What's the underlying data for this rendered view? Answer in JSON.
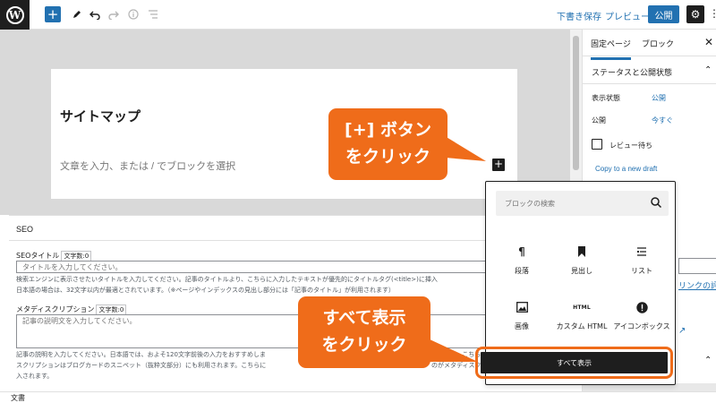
{
  "toolbar": {
    "add_icon": "plus-icon",
    "save_draft": "下書き保存",
    "preview": "プレビュー",
    "publish": "公開"
  },
  "editor": {
    "page_title": "サイトマップ",
    "block_placeholder": "文章を入力、または / でブロックを選択"
  },
  "sidebar": {
    "tabs": [
      "固定ページ",
      "ブロック"
    ],
    "section_title": "ステータスと公開状態",
    "visibility_label": "表示状態",
    "visibility_value": "公開",
    "publish_label": "公開",
    "publish_value": "今すぐ",
    "pending_review": "レビュー待ち",
    "copy_link": "Copy to a new draft",
    "partial_link": "リンクの評"
  },
  "seo": {
    "header": "SEO",
    "title_label": "SEOタイトル",
    "char_count_label": "文字数:",
    "title_count": "0",
    "title_placeholder": "タイトルを入力してください。",
    "title_help_1": "検索エンジンに表示させたいタイトルを入力してください。記事のタイトルより、こちらに入力したテキストが優先的にタイトルタグ(<title>)に挿入",
    "title_help_2": "日本語の場合は、32文字以内が最適とされています。（※ページやインデックスの見出し部分には「記事のタイトル」が利用されます）",
    "desc_label": "メタディスクリプション",
    "desc_count": "0",
    "desc_placeholder": "記事の説明文を入力してください。",
    "desc_help_1": "記事の説明を入力してください。日本語では、およそ120文字前後の入力をおすすめしま",
    "desc_help_1b": "されます。こちら",
    "desc_help_2": "スクリプションはブログカードのスニペット（抜粋文部分）にも利用されます。こちらに",
    "desc_help_2b": "のがメタディスク",
    "desc_help_3": "入されます。"
  },
  "inserter": {
    "search_placeholder": "ブロックの検索",
    "blocks": [
      {
        "label": "段落",
        "icon": "paragraph-icon"
      },
      {
        "label": "見出し",
        "icon": "bookmark-icon"
      },
      {
        "label": "リスト",
        "icon": "list-icon"
      },
      {
        "label": "画像",
        "icon": "image-icon"
      },
      {
        "label": "カスタム HTML",
        "icon": "html-icon"
      },
      {
        "label": "アイコンボックス",
        "icon": "alert-icon"
      }
    ],
    "show_all": "すべて表示"
  },
  "callouts": {
    "plus_line1": "[+] ボタン",
    "plus_line2": "をクリック",
    "showall_line1": "すべて表示",
    "showall_line2": "をクリック"
  },
  "footer": {
    "breadcrumb": "文書"
  },
  "colors": {
    "accent": "#2271b1",
    "callout": "#ef6c1a",
    "dark": "#1e1e1e",
    "canvas_bg": "#d9d9d9"
  }
}
